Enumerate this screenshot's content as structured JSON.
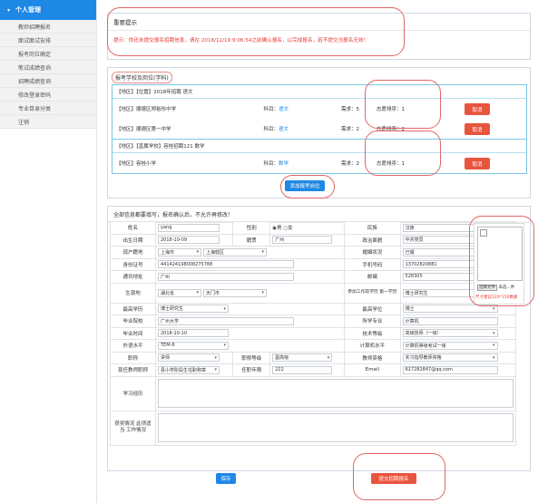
{
  "sidebar": {
    "title": "个人管理",
    "items": [
      "教师招聘报名",
      "面试面试安排",
      "报考岗位确定",
      "笔试成绩查询",
      "招聘成绩查询",
      "修改登录密码",
      "专业目录分类",
      "注销"
    ]
  },
  "notice": {
    "title": "重要提示",
    "message": "提示：你还未提交报名招聘信息，请在 2018/12/19 9:06:54之前确认报名，以完成报名，若不提交当报名无效！"
  },
  "school": {
    "title": "报考学校及岗位(学科)",
    "add_label": "添加报考岗位",
    "groups": [
      {
        "header": "【地区】【位置】2018年招聘 语文",
        "rows": [
          {
            "tag": "【地区】",
            "name": "顺德区郑裕彤中学",
            "subject_label": "科目：",
            "subject": "语文",
            "need": "需求：5",
            "order": "志愿排序：1",
            "cancel": "取消"
          },
          {
            "tag": "【地区】",
            "name": "顺德区第一中学",
            "subject_label": "科目：",
            "subject": "语文",
            "need": "需求：2",
            "order": "志愿排序：2",
            "cancel": "取消"
          }
        ]
      },
      {
        "header": "【地区】【直属学校】容桂招聘121 数学",
        "rows": [
          {
            "tag": "【地区】",
            "name": "容桂小学",
            "subject_label": "科目：",
            "subject": "数学",
            "need": "需求：2",
            "order": "志愿排序：1",
            "cancel": "取消"
          }
        ]
      }
    ]
  },
  "info": {
    "title": "全部信息都要填写，报名确认后，不允许再修改！",
    "name_label": "姓名",
    "name_value": "yang",
    "gender_label": "性别",
    "gender_male": "男",
    "gender_female": "女",
    "ethnic_label": "民族",
    "ethnic_value": "汉族",
    "birth_label": "出生日期",
    "birth_value": "2018-10-09",
    "native_label": "籍贯",
    "native_value": "广州",
    "politics_label": "政治面貌",
    "politics_value": "中共党员",
    "hukou_label": "现户籍地",
    "hukou_city": "上海市",
    "hukou_district": "上海辖区",
    "marital_label": "婚姻状况",
    "marital_value": "已婚",
    "id_label": "身份证号",
    "id_value": "441424198008275788",
    "phone_label": "手机号码",
    "phone_value": "13702820881",
    "address_label": "通讯地址",
    "address_value": "广州",
    "post_label": "邮编",
    "post_value": "528305",
    "origin_label": "生源地",
    "origin_province": "湖北省",
    "origin_city": "天门市",
    "firstedu_label": "参加工作前学历 第一学历",
    "firstedu_value": "博士研究生",
    "highedu_label": "最高学历",
    "highedu_value": "博士研究生",
    "highdeg_label": "最高学位",
    "highdeg_value": "博士",
    "school_label": "毕业院校",
    "school_value": "广州大学",
    "major_label": "所学专业",
    "major_value": "计算机",
    "gradtime_label": "毕业时间",
    "gradtime_value": "2018-10-10",
    "tech_label": "技术等级",
    "tech_value": "高级技师（一级）",
    "lang_label": "外语水平",
    "lang_value": "TEM-8",
    "computer_label": "计算机水平",
    "computer_value": "计算机等级考试一级",
    "title_label": "职称",
    "title_value": "讲师",
    "titlelevel_label": "职称等级",
    "titlelevel_value": "副高级",
    "cert_label": "教师资格",
    "cert_value": "实习指导教师资格",
    "job_label": "现任教师职称",
    "job_value": "县小学阶段生任职称章",
    "jobyear_label": "任职年限",
    "jobyear_value": "222",
    "email_label": "Email",
    "email_value": "617282847@qq.com",
    "study_label": "学习经历",
    "award_label": "获奖情况 此项适当 工作情况",
    "photo_choose": "选择文件",
    "photo_none": "未选...件",
    "photo_hint": "尺寸建议120*150像素"
  },
  "actions": {
    "save": "保存",
    "submit": "提交招聘报名"
  },
  "colors": {
    "primary": "#1e88e5",
    "danger": "#e8553e",
    "ring": "#e06666"
  }
}
